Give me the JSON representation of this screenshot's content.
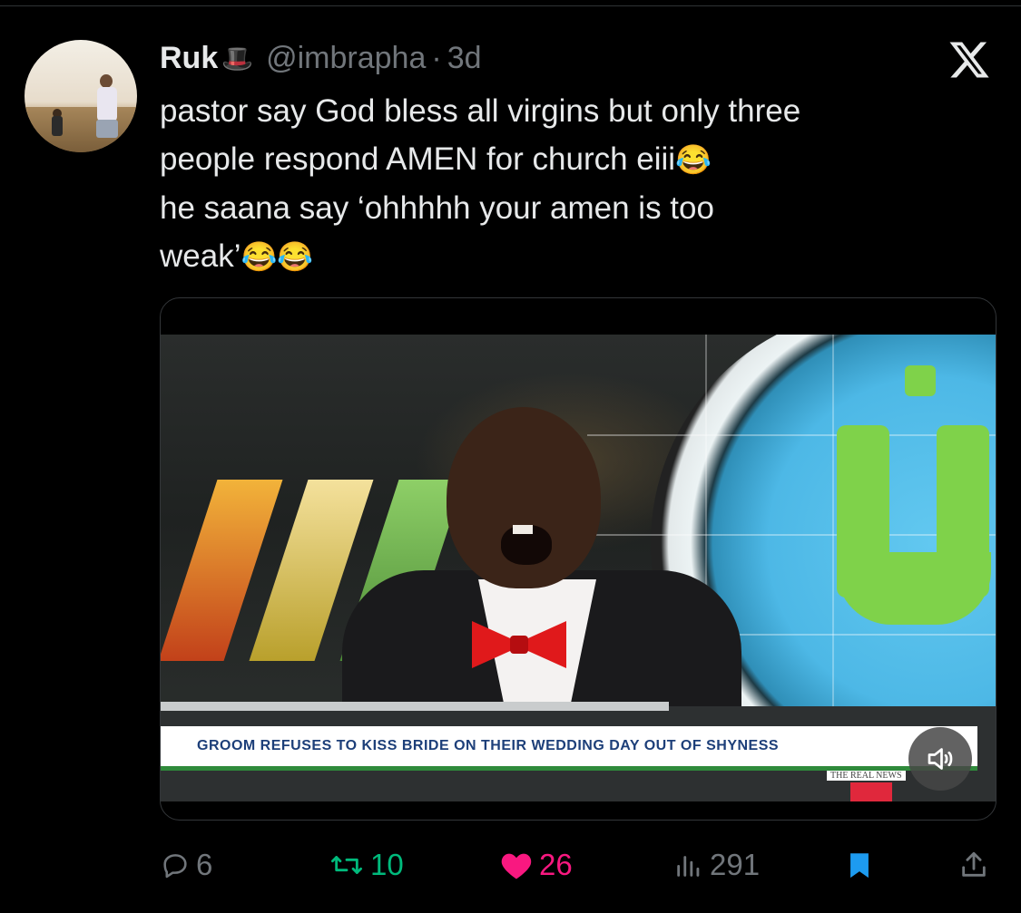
{
  "tweet": {
    "author_name": "Ruk",
    "name_emoji": "🎩",
    "handle": "@imbrapha",
    "separator": "·",
    "time": "3d",
    "text_lines": [
      "pastor say God bless all virgins but only three",
      "people respond AMEN for church eiii",
      "he saana say ‘ohhhhh your amen is too",
      "weak’"
    ],
    "emoji_laugh": "😂"
  },
  "media": {
    "ticker": "GROOM REFUSES TO KISS BRIDE ON THEIR WEDDING DAY OUT OF SHYNESS",
    "subtag": "THE REAL NEWS",
    "volume_icon": "speaker-icon"
  },
  "actions": {
    "replies": "6",
    "retweets": "10",
    "likes": "26",
    "views": "291"
  },
  "colors": {
    "background": "#000000",
    "text": "#e7e9ea",
    "muted": "#71767b",
    "retweet": "#00ba7c",
    "like": "#f91880",
    "bookmark": "#1d9bf0"
  }
}
